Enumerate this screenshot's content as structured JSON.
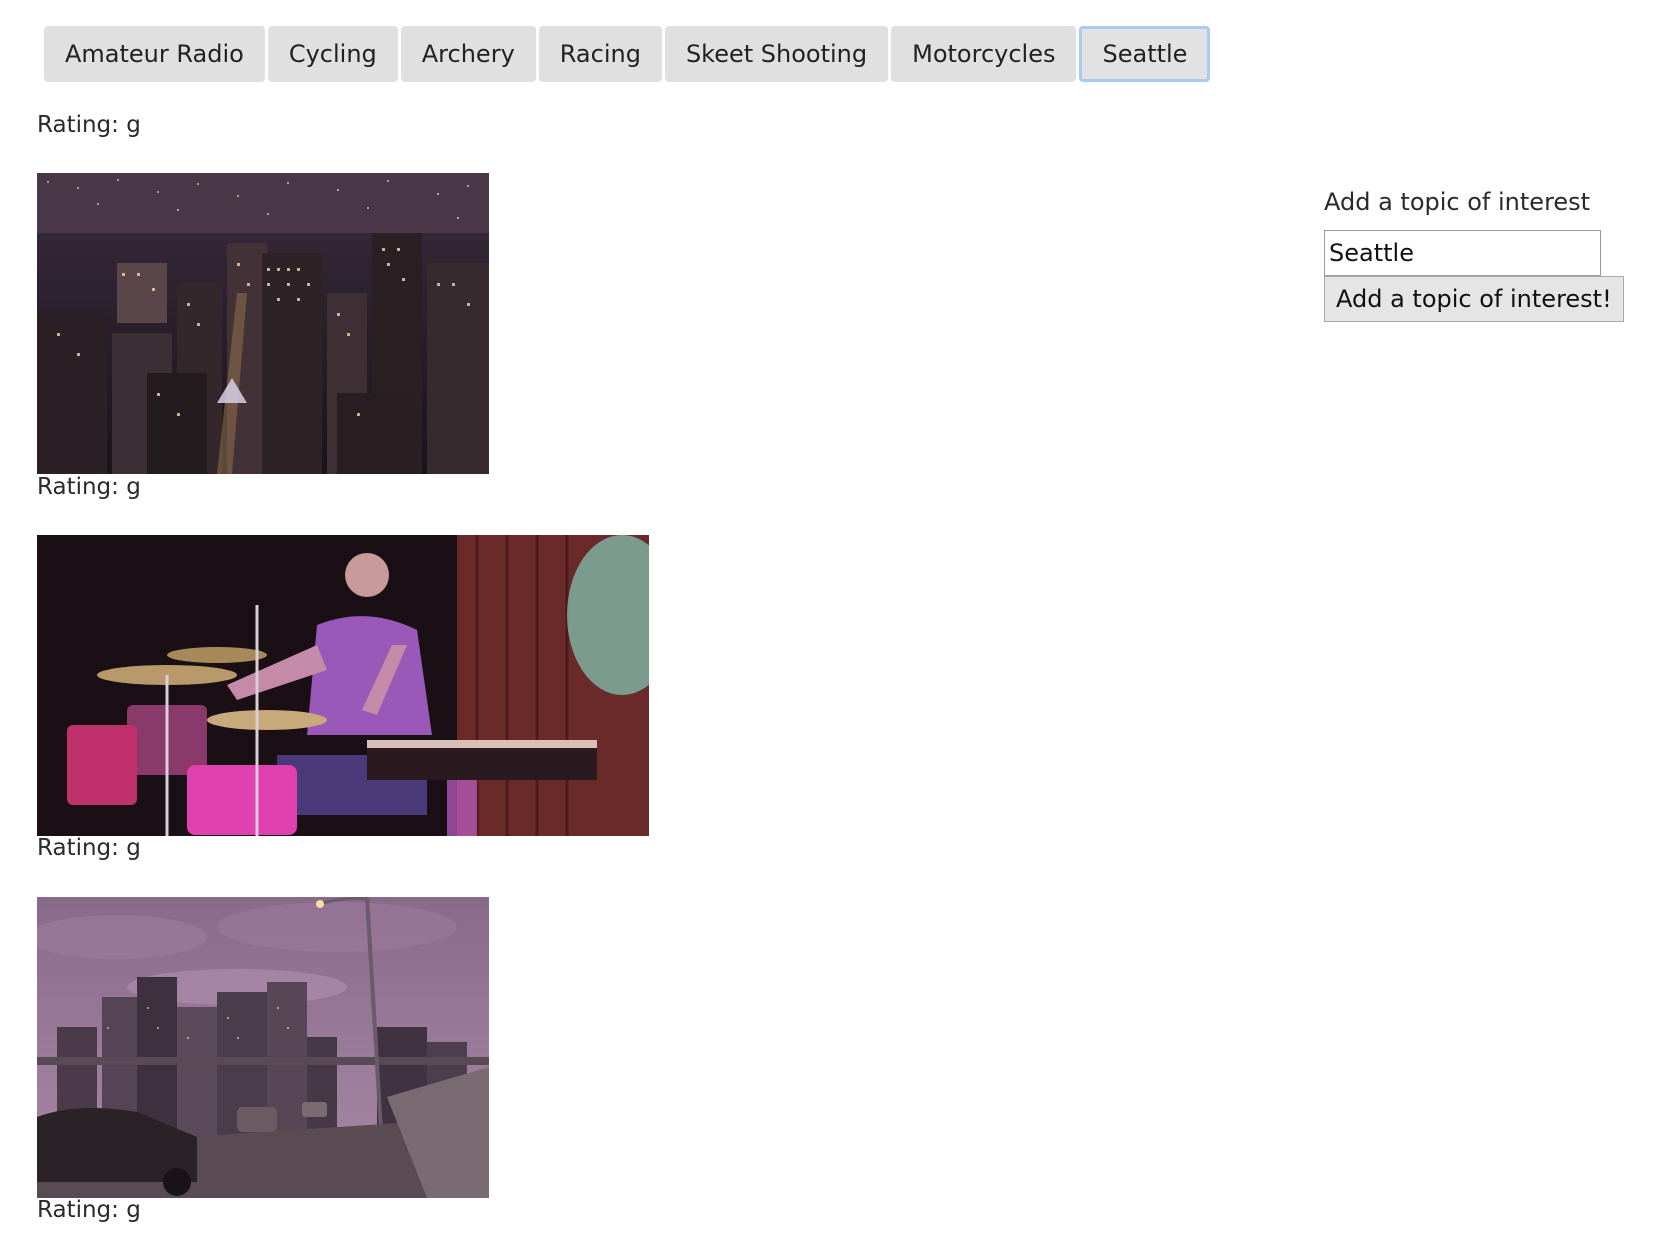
{
  "topics": [
    {
      "label": "Amateur Radio",
      "active": false
    },
    {
      "label": "Cycling",
      "active": false
    },
    {
      "label": "Archery",
      "active": false
    },
    {
      "label": "Racing",
      "active": false
    },
    {
      "label": "Skeet Shooting",
      "active": false
    },
    {
      "label": "Motorcycles",
      "active": false
    },
    {
      "label": "Seattle",
      "active": true
    }
  ],
  "gifs": [
    {
      "rating_label": "Rating: g",
      "image_icon": "city-night-aerial-image"
    },
    {
      "rating_label": "Rating: g",
      "image_icon": "drummer-stage-image"
    },
    {
      "rating_label": "Rating: g",
      "image_icon": "city-skyline-highway-image"
    }
  ],
  "form": {
    "label": "Add a topic of interest",
    "input_value": "Seattle",
    "button_label": "Add a topic of interest!"
  },
  "colors": {
    "button_bg": "#e0e0e0",
    "active_border": "#a9cbf3"
  }
}
